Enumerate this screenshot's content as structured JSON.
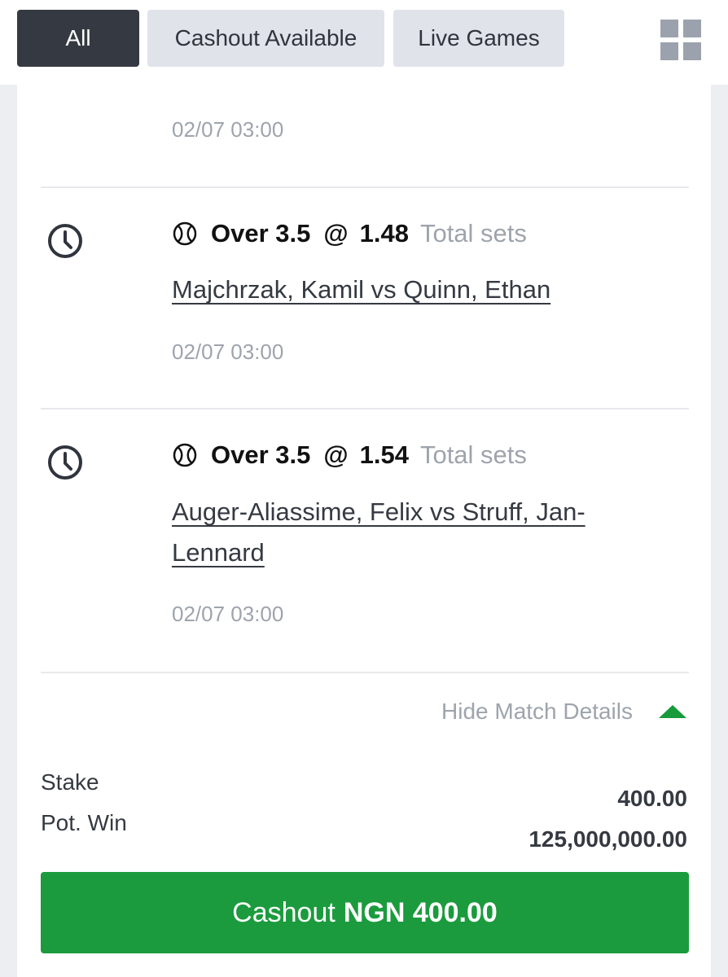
{
  "tabs": [
    {
      "label": "All",
      "active": true
    },
    {
      "label": "Cashout Available",
      "active": false
    },
    {
      "label": "Live Games",
      "active": false
    }
  ],
  "colors": {
    "accent_green": "#1b9b3d",
    "tab_active": "#353a42",
    "tab_inactive": "#e0e3e9"
  },
  "bet": {
    "first_date": "02/07 03:00",
    "selections": [
      {
        "icon": "tennis-ball-icon",
        "pick": "Over 3.5",
        "at": "@",
        "odds": "1.48",
        "market": "Total sets",
        "match": "Majchrzak, Kamil vs Quinn, Ethan",
        "date": "02/07 03:00"
      },
      {
        "icon": "tennis-ball-icon",
        "pick": "Over 3.5",
        "at": "@",
        "odds": "1.54",
        "market": "Total sets",
        "match": "Auger-Aliassime, Felix vs Struff, Jan-Lennard",
        "date": "02/07 03:00"
      }
    ],
    "hide_details_label": "Hide Match Details",
    "stake_label": "Stake",
    "stake_value": "400.00",
    "potwin_label": "Pot. Win",
    "potwin_value": "125,000,000.00",
    "cashout_label": "Cashout",
    "cashout_amount": "NGN 400.00"
  }
}
